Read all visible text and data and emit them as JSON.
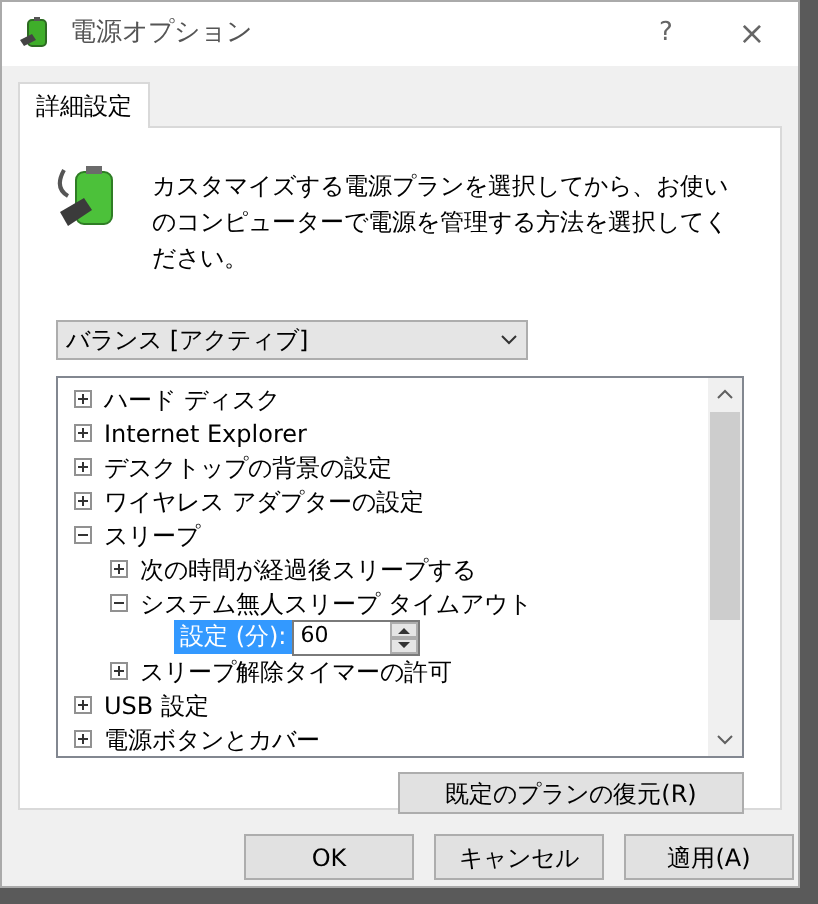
{
  "window": {
    "title": "電源オプション",
    "buttons": [
      "?",
      "×"
    ]
  },
  "tabs": [
    {
      "label": "詳細設定",
      "selected": true
    }
  ],
  "description": "カスタマイズする電源プランを選択してから、お使いのコンピューターで電源を管理する方法を選択してください。",
  "plan_dropdown": {
    "value": "バランス [アクティブ]"
  },
  "tree": [
    {
      "label": "ハード ディスク",
      "expanded": false
    },
    {
      "label": "Internet Explorer",
      "expanded": false
    },
    {
      "label": "デスクトップの背景の設定",
      "expanded": false
    },
    {
      "label": "ワイヤレス アダプターの設定",
      "expanded": false
    },
    {
      "label": "スリープ",
      "expanded": true,
      "children": [
        {
          "label": "次の時間が経過後スリープする",
          "expanded": false
        },
        {
          "label": "システム無人スリープ タイムアウト",
          "expanded": true,
          "children": [
            {
              "kind": "setting",
              "label": "設定 (分):",
              "value": "60",
              "selected": true
            }
          ]
        },
        {
          "label": "スリープ解除タイマーの許可",
          "expanded": false
        }
      ]
    },
    {
      "label": "USB 設定",
      "expanded": false
    },
    {
      "label": "電源ボタンとカバー",
      "expanded": false
    }
  ],
  "restore_button": "既定のプランの復元(R)",
  "buttons": [
    "OK",
    "キャンセル",
    "適用(A)"
  ]
}
